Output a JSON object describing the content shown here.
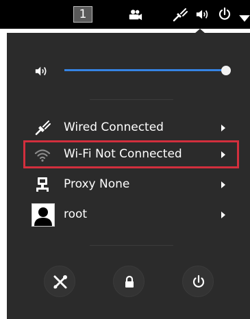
{
  "topbar": {
    "workspace_number": "1"
  },
  "icons": {
    "camera": "camera-icon",
    "wired_status": "wired-network-icon",
    "volume_status": "volume-icon",
    "power_status": "power-icon",
    "dropdown": "chevron-down-icon"
  },
  "menu": {
    "volume_level": 1.0,
    "items": [
      {
        "label": "Wired Connected",
        "icon": "wired-network-icon"
      },
      {
        "label": "Wi-Fi Not Connected",
        "icon": "wifi-icon"
      },
      {
        "label": "Proxy None",
        "icon": "proxy-icon"
      },
      {
        "label": "root",
        "icon": "user-avatar"
      }
    ],
    "bottom_buttons": [
      "settings",
      "lock",
      "power"
    ]
  },
  "colors": {
    "highlight": "#d32f3d",
    "slider_fill": "#3584e4",
    "menu_bg": "#2b2b2b"
  }
}
